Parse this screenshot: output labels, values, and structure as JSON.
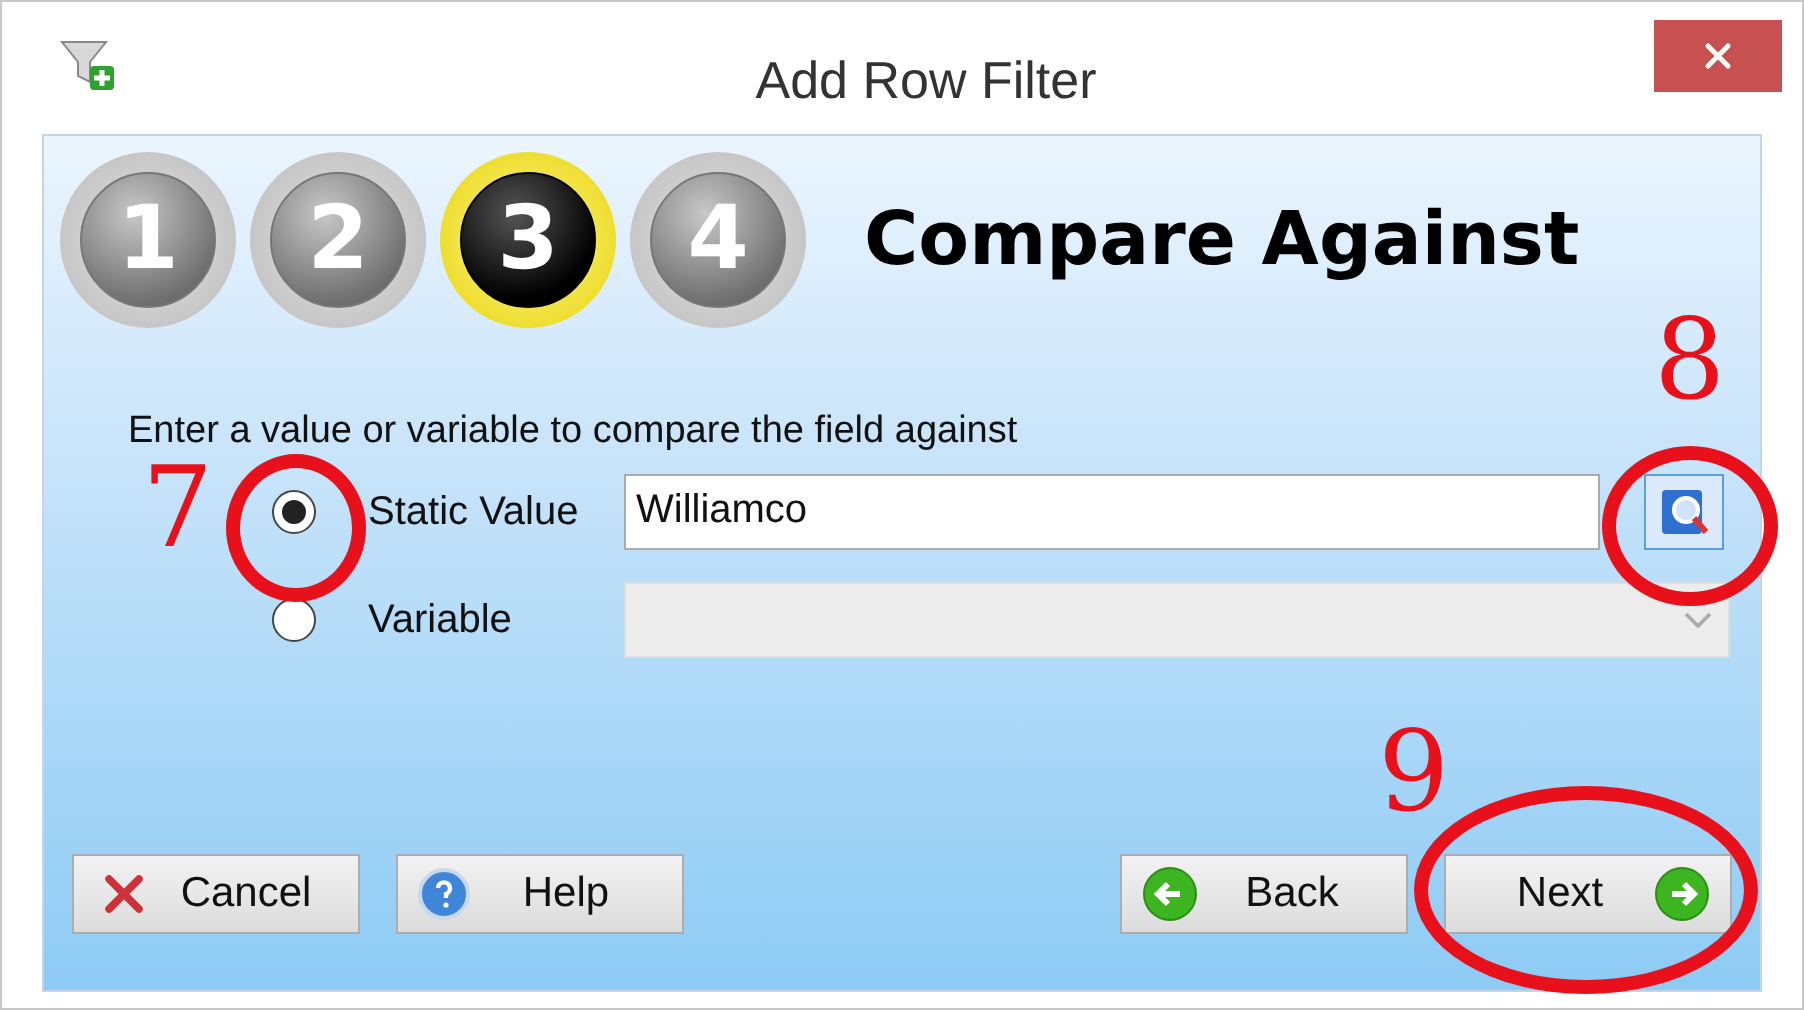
{
  "window": {
    "title": "Add Row Filter"
  },
  "steps": [
    {
      "label": "1",
      "selected": false
    },
    {
      "label": "2",
      "selected": false
    },
    {
      "label": "3",
      "selected": true
    },
    {
      "label": "4",
      "selected": false
    }
  ],
  "heading": "Compare Against",
  "instruction": "Enter a value or variable to compare the field against",
  "options": [
    {
      "label": "Static Value",
      "selected": true,
      "field": {
        "kind": "text",
        "value": "Williamco",
        "disabled": false
      }
    },
    {
      "label": "Variable",
      "selected": false,
      "field": {
        "kind": "dropdown",
        "disabled": true
      }
    }
  ],
  "buttons": [
    {
      "label": "Cancel",
      "kind": "cancel"
    },
    {
      "label": "Help",
      "kind": "help"
    },
    {
      "label": "Back",
      "kind": "back"
    },
    {
      "label": "Next",
      "kind": "next"
    }
  ],
  "annotations": [
    {
      "label": "7"
    },
    {
      "label": "8"
    },
    {
      "label": "9"
    }
  ]
}
